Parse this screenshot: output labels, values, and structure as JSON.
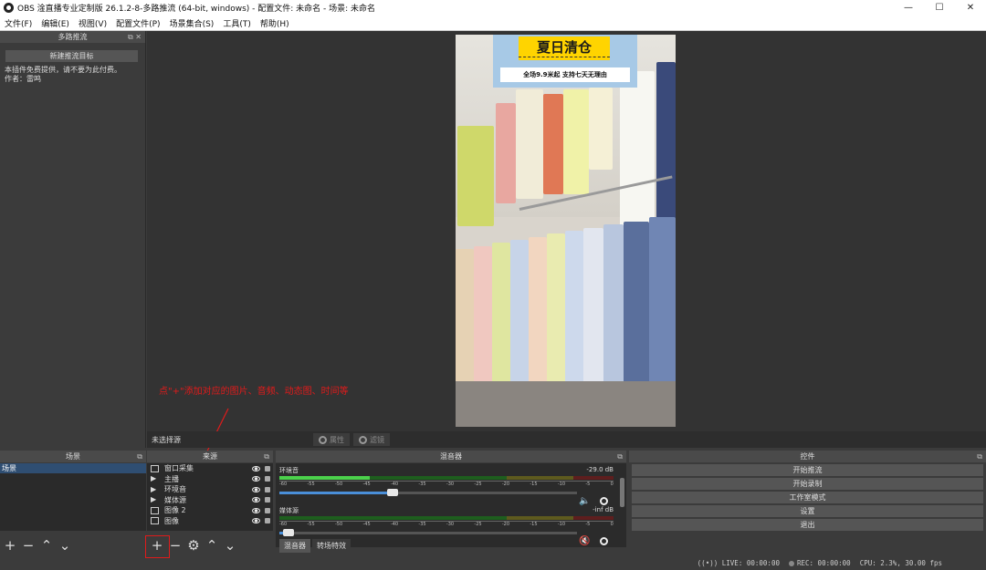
{
  "window": {
    "title": "OBS 淦直播专业定制版 26.1.2-8-多路推流 (64-bit, windows) - 配置文件: 未命名 - 场景: 未命名",
    "minimize": "—",
    "maximize": "☐",
    "close": "✕"
  },
  "menu": [
    "文件(F)",
    "编辑(E)",
    "视图(V)",
    "配置文件(P)",
    "场景集合(S)",
    "工具(T)",
    "帮助(H)"
  ],
  "left_dock": {
    "title": "多路推流",
    "new_target_label": "新建推流目标",
    "info_line1": "本插件免费提供，请不要为此付费。",
    "info_line2": "作者：雷鸣"
  },
  "preview": {
    "sign_title": "夏日清仓",
    "sign_subtitle": "全场9.9米起 支持七天无理由"
  },
  "annotation": "点\"+\"添加对应的图片、音频、动态图、时间等",
  "prop_bar": {
    "no_source": "未选择源",
    "properties": "属性",
    "filters": "滤镜"
  },
  "scenes": {
    "title": "场景",
    "items": [
      "场景"
    ]
  },
  "sources": {
    "title": "来源",
    "items": [
      {
        "label": "窗口采集",
        "icon": "window-capture-icon"
      },
      {
        "label": "主播",
        "icon": "media-play-icon"
      },
      {
        "label": "环境音",
        "icon": "media-play-icon"
      },
      {
        "label": "媒体源",
        "icon": "media-play-icon"
      },
      {
        "label": "图像 2",
        "icon": "image-icon"
      },
      {
        "label": "图像",
        "icon": "image-icon"
      }
    ]
  },
  "mixer": {
    "title": "混音器",
    "tracks": [
      {
        "name": "环境音",
        "db": "-29.0 dB",
        "level": 0.27,
        "volume": 0.38
      },
      {
        "name": "媒体源",
        "db": "-inf dB",
        "level": 0,
        "volume": 0.03,
        "muted": true
      }
    ],
    "scale": [
      "-60",
      "-55",
      "-50",
      "-45",
      "-40",
      "-35",
      "-30",
      "-25",
      "-20",
      "-15",
      "-10",
      "-5",
      "0"
    ],
    "tabs": [
      "混音器",
      "转场特效"
    ]
  },
  "controls": {
    "title": "控件",
    "buttons": [
      "开始推流",
      "开始录制",
      "工作室模式",
      "设置",
      "退出"
    ]
  },
  "status": {
    "live": "LIVE: 00:00:00",
    "rec": "REC: 00:00:00",
    "cpu": "CPU: 2.3%, 30.00 fps"
  },
  "colors": {
    "accent_annotation": "#e01b1b",
    "sign_yellow": "#ffd400",
    "selected_scene": "#2f4e72"
  }
}
